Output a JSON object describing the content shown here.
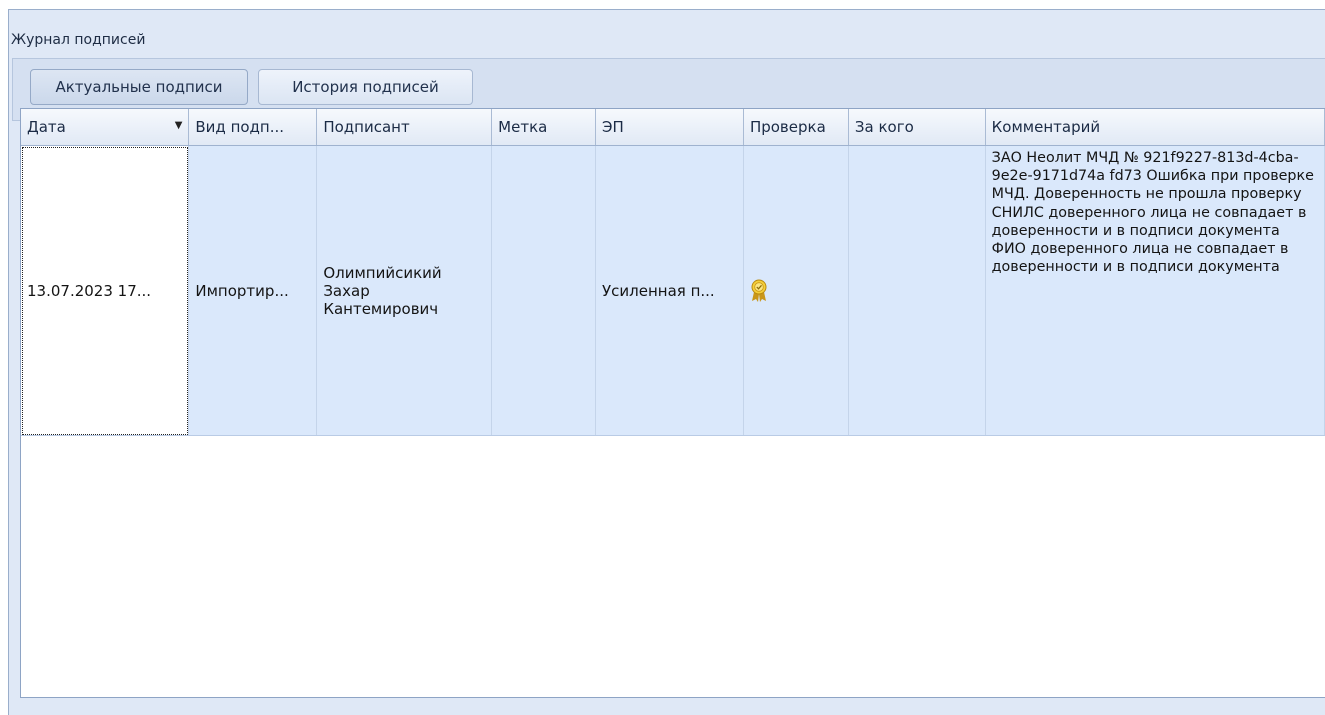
{
  "window": {
    "title": "Журнал подписей"
  },
  "tabs": [
    {
      "label": "Актуальные подписи"
    },
    {
      "label": "История подписей"
    }
  ],
  "columns": [
    "Дата",
    "Вид подп...",
    "Подписант",
    "Метка",
    "ЭП",
    "Проверка",
    "За кого",
    "Комментарий"
  ],
  "rows": [
    {
      "date": "13.07.2023 17...",
      "type": "Импортир...",
      "signer": "Олимпийсикий Захар Кантемирович",
      "mark": "",
      "ep": "Усиленная п...",
      "check_icon": "award-badge-icon",
      "for_whom": "",
      "comment": "ЗАО Неолит\nМЧД №\n921f9227-813d-4cba-9e2e-9171d74a\nfd73\nОшибка при проверке МЧД.\nДоверенность не прошла проверку\nСНИЛС доверенного лица не\nсовпадает в доверенности и в\nподписи документа\nФИО доверенного лица не\nсовпадает в доверенности и в\nподписи документа"
    }
  ],
  "colors": {
    "selected_row": "#dae8fb",
    "window_bg": "#dfe8f6",
    "badge_gold": "#e3b621"
  }
}
